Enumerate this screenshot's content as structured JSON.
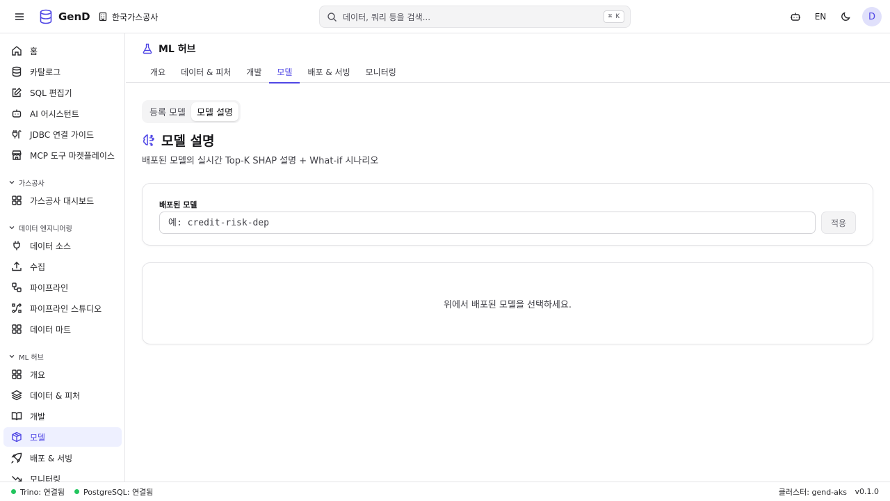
{
  "topbar": {
    "brand": "GenD",
    "org": "한국가스공사",
    "search_placeholder": "데이터, 쿼리 등을 검색...",
    "search_shortcut": "⌘ K",
    "lang": "EN",
    "avatar_initial": "D"
  },
  "sidebar": {
    "top_items": [
      {
        "label": "홈",
        "icon": "home-icon"
      },
      {
        "label": "카탈로그",
        "icon": "database-icon"
      },
      {
        "label": "SQL 편집기",
        "icon": "edit-icon"
      },
      {
        "label": "AI 어시스턴트",
        "icon": "bot-icon"
      },
      {
        "label": "JDBC 연결 가이드",
        "icon": "cable-icon"
      },
      {
        "label": "MCP 도구 마켓플레이스",
        "icon": "store-icon"
      }
    ],
    "groups": [
      {
        "title": "가스공사",
        "items": [
          {
            "label": "가스공사 대시보드",
            "icon": "grid-icon"
          }
        ]
      },
      {
        "title": "데이터 엔지니어링",
        "items": [
          {
            "label": "데이터 소스",
            "icon": "plug-icon"
          },
          {
            "label": "수집",
            "icon": "upload-icon"
          },
          {
            "label": "파이프라인",
            "icon": "workflow-icon"
          },
          {
            "label": "파이프라인 스튜디오",
            "icon": "spline-icon"
          },
          {
            "label": "데이터 마트",
            "icon": "grid-icon"
          }
        ]
      },
      {
        "title": "ML 허브",
        "items": [
          {
            "label": "개요",
            "icon": "grid-icon"
          },
          {
            "label": "데이터 & 피처",
            "icon": "layers-icon"
          },
          {
            "label": "개발",
            "icon": "book-icon"
          },
          {
            "label": "모델",
            "icon": "box-icon",
            "active": true
          },
          {
            "label": "배포 & 서빙",
            "icon": "rocket-icon"
          },
          {
            "label": "모니터링",
            "icon": "trend-icon"
          }
        ]
      }
    ]
  },
  "page": {
    "title": "ML 허브",
    "tabs": [
      {
        "label": "개요"
      },
      {
        "label": "데이터 & 피처"
      },
      {
        "label": "개발"
      },
      {
        "label": "모델",
        "active": true
      },
      {
        "label": "배포 & 서빙"
      },
      {
        "label": "모니터링"
      }
    ],
    "segments": [
      {
        "label": "등록 모델"
      },
      {
        "label": "모델 설명",
        "active": true
      }
    ],
    "section_title": "모델 설명",
    "section_desc": "배포된 모델의 실시간 Top-K SHAP 설명 + What-if 시나리오",
    "field_label": "배포된 모델",
    "input_placeholder": "예: credit-risk-dep",
    "input_value": "",
    "apply_label": "적용",
    "empty_message": "위에서 배포된 모델을 선택하세요."
  },
  "statusbar": {
    "trino": "Trino: 연결됨",
    "postgres": "PostgreSQL: 연결됨",
    "cluster": "클러스터: gend-aks",
    "version": "v0.1.0"
  },
  "colors": {
    "accent": "#4f46e5",
    "status_ok": "#22c55e"
  }
}
